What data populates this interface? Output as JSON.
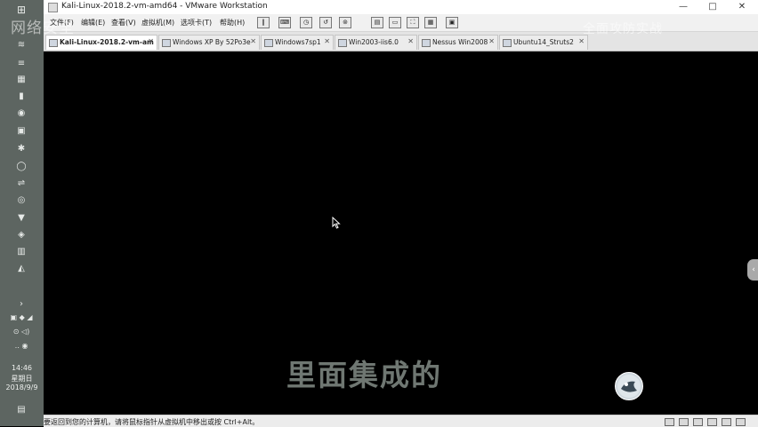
{
  "window": {
    "title": "Kali-Linux-2018.2-vm-amd64 - VMware Workstation"
  },
  "menu": [
    "文件(F)",
    "编辑(E)",
    "查看(V)",
    "虚拟机(M)",
    "选项卡(T)",
    "帮助(H)"
  ],
  "tabs": [
    {
      "label": "Kali-Linux-2018.2-vm-am",
      "active": true
    },
    {
      "label": "Windows XP By 52Po3e",
      "active": false
    },
    {
      "label": "Windows7sp1",
      "active": false
    },
    {
      "label": "Win2003-iis6.0",
      "active": false
    },
    {
      "label": "Nessus Win2008",
      "active": false
    },
    {
      "label": "Ubuntu14_Struts2",
      "active": false
    }
  ],
  "watermark": {
    "left": "网络安全",
    "right": "全面攻防实战"
  },
  "subtitle": "里面集成的",
  "status": {
    "text": "要返回到您的计算机，请将鼠标指针从虚拟机中移出或按 Ctrl+Alt。"
  },
  "taskbar": {
    "time": "14:46",
    "weekday": "星期日",
    "date": "2018/9/9",
    "icons": [
      "windows-icon",
      "app-icon",
      "app-icon",
      "app-icon",
      "app-icon",
      "app-icon",
      "app-icon",
      "app-icon",
      "app-icon",
      "app-icon",
      "app-icon",
      "app-icon",
      "app-icon",
      "app-icon",
      "app-icon"
    ]
  },
  "colors": {
    "taskbar": "#5d6561",
    "vm_background": "#000000",
    "subtitle": "#6f7772"
  }
}
